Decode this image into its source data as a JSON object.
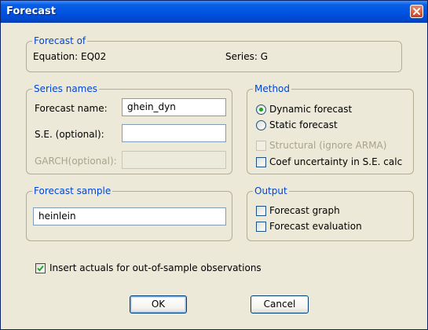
{
  "window": {
    "title": "Forecast"
  },
  "forecast_of": {
    "legend": "Forecast of",
    "equation": "Equation: EQ02",
    "series": "Series: G"
  },
  "series_names": {
    "legend": "Series names",
    "forecast_name_label": "Forecast name:",
    "forecast_name_value": "ghein_dyn",
    "se_label": "S.E. (optional):",
    "se_value": "",
    "garch_label": "GARCH(optional):",
    "garch_value": ""
  },
  "method": {
    "legend": "Method",
    "dynamic_label": "Dynamic forecast",
    "dynamic_selected": true,
    "static_label": "Static forecast",
    "static_selected": false,
    "structural_label": "Structural (ignore ARMA)",
    "structural_checked": false,
    "coef_label": "Coef uncertainty in S.E. calc",
    "coef_checked": false
  },
  "forecast_sample": {
    "legend": "Forecast sample",
    "value": "heinlein"
  },
  "output": {
    "legend": "Output",
    "graph_label": "Forecast graph",
    "graph_checked": false,
    "evaluation_label": "Forecast evaluation",
    "evaluation_checked": false
  },
  "insert_actuals": {
    "label": "Insert actuals for out-of-sample observations",
    "checked": true
  },
  "buttons": {
    "ok": "OK",
    "cancel": "Cancel"
  },
  "colors": {
    "accent": "#0046d5",
    "title_bar": "#0054e3",
    "dialog_bg": "#ece9d8",
    "radio_dot": "#21a121",
    "check_mark": "#21a121"
  }
}
